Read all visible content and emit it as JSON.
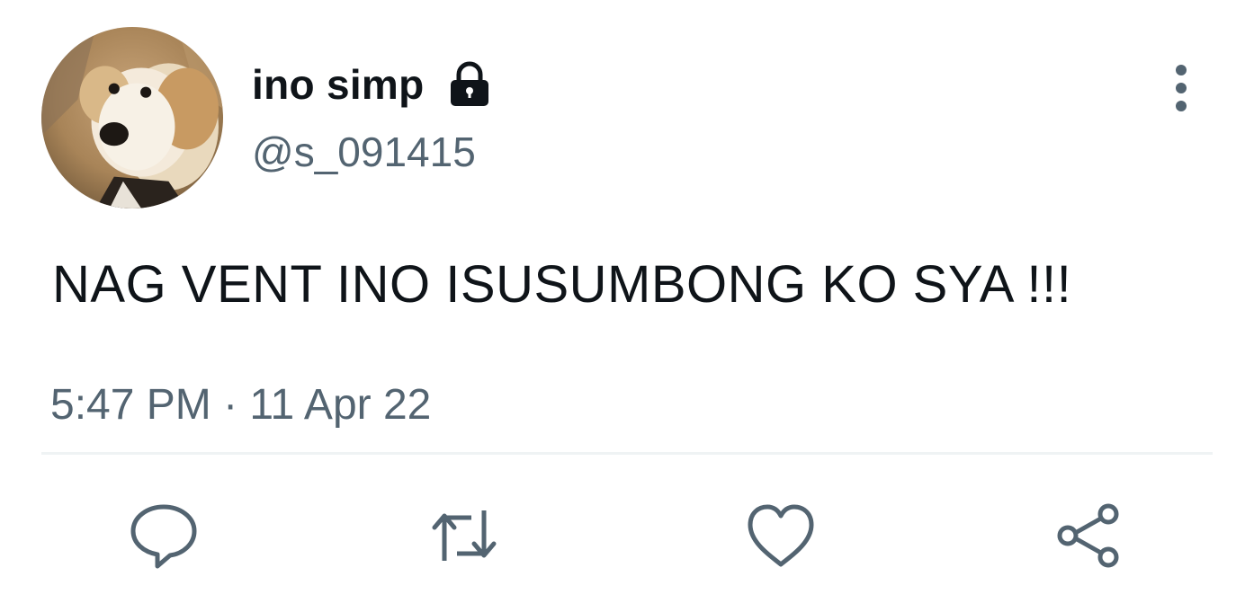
{
  "tweet": {
    "author": {
      "display_name": "ino simp",
      "handle": "@s_091415",
      "protected_icon": "lock-icon",
      "avatar": "dog-photo-avatar"
    },
    "text": "NAG VENT INO ISUSUMBONG KO SYA !!!",
    "timestamp": "5:47 PM · 11 Apr 22"
  },
  "actions": {
    "reply": "reply-icon",
    "retweet": "retweet-icon",
    "like": "heart-icon",
    "share": "share-icon",
    "more": "more-vertical-icon"
  },
  "colors": {
    "primary_text": "#0f1419",
    "secondary_text": "#536471",
    "icon": "#536471",
    "divider": "#eff3f4"
  }
}
